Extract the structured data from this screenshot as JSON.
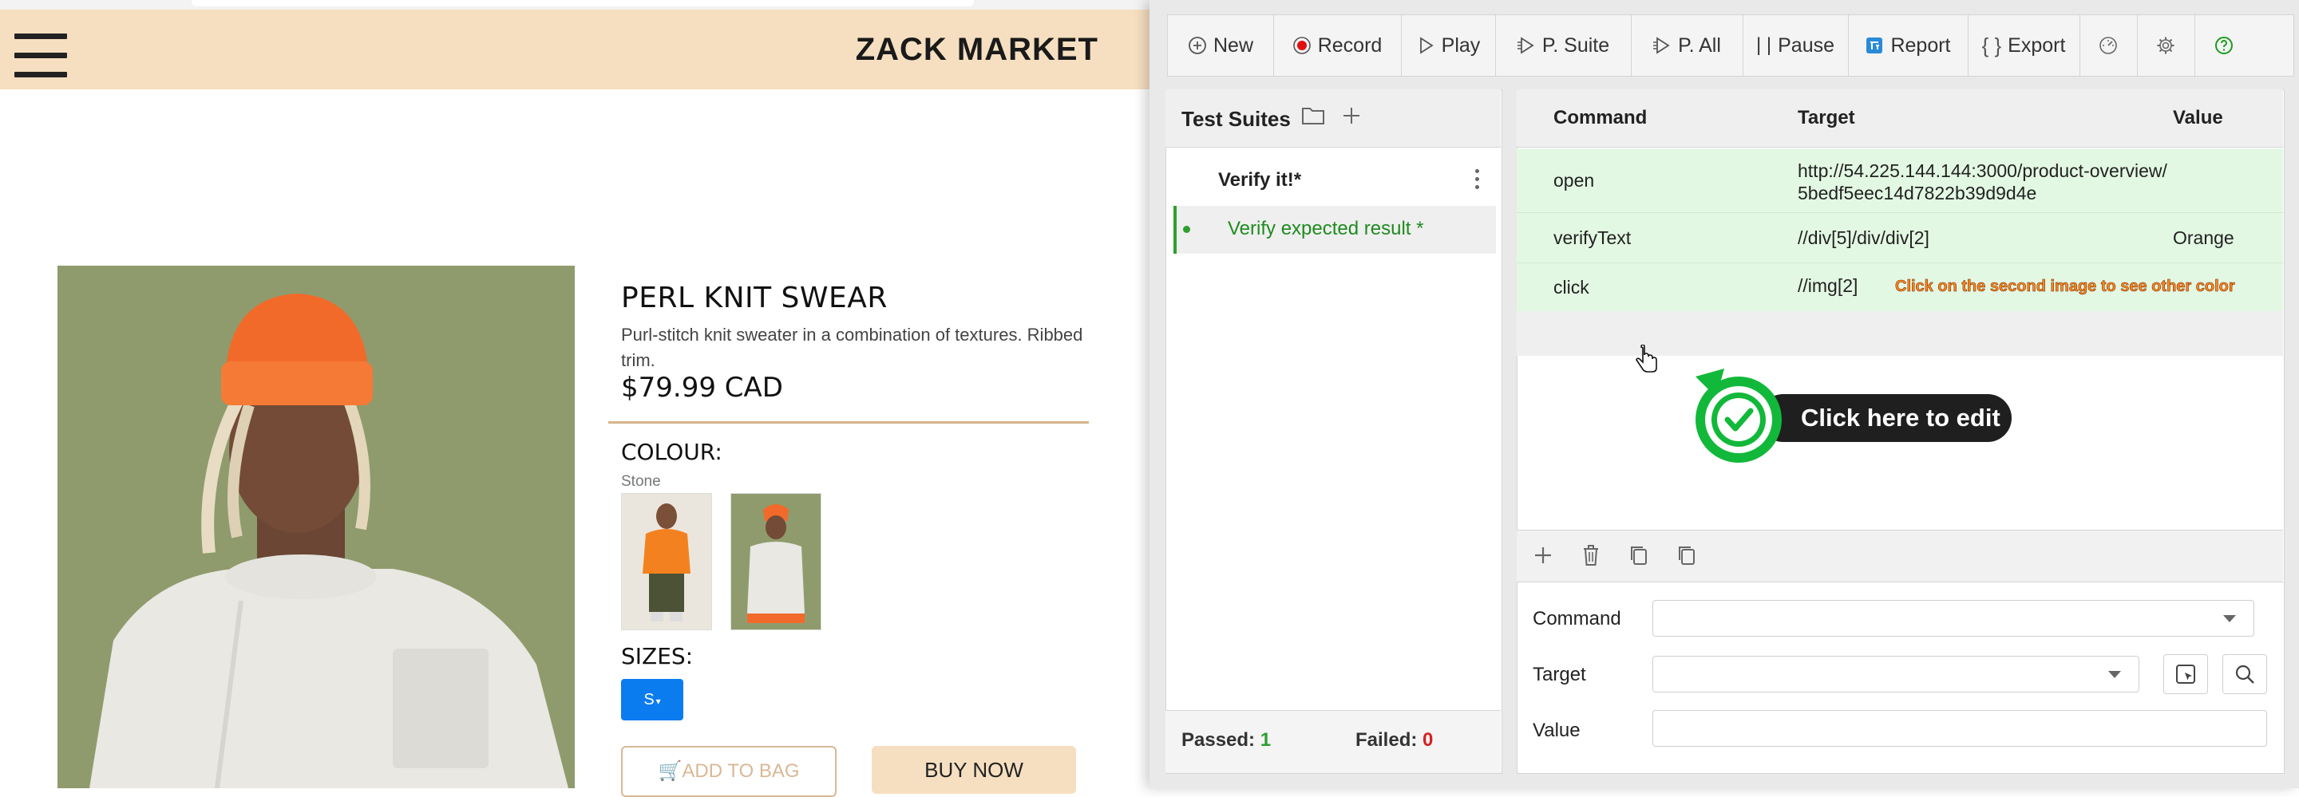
{
  "site": {
    "brand": "ZACK MARKET",
    "product": {
      "title": "PERL KNIT SWEAR",
      "description": "Purl-stitch knit sweater in a combination of textures. Ribbed trim.",
      "price": "$79.99 CAD",
      "colour_label": "COLOUR:",
      "colour_value": "Stone",
      "sizes_label": "SIZES:",
      "size_selected": "S",
      "add_to_bag": "ADD TO BAG",
      "buy_now": "BUY NOW"
    }
  },
  "ide": {
    "toolbar": {
      "new": "New",
      "record": "Record",
      "play": "Play",
      "play_suite": "P. Suite",
      "play_all": "P. All",
      "pause": "Pause",
      "report": "Report",
      "export": "Export"
    },
    "suites": {
      "title": "Test Suites",
      "suite_name": "Verify it!*",
      "test_name": "Verify expected result *",
      "passed_label": "Passed:",
      "passed_count": "1",
      "failed_label": "Failed:",
      "failed_count": "0"
    },
    "table": {
      "headers": {
        "command": "Command",
        "target": "Target",
        "value": "Value"
      },
      "rows": [
        {
          "command": "open",
          "target": "http://54.225.144.144:3000/product-overview/5bedf5eec14d7822b39d9d4e",
          "value": ""
        },
        {
          "command": "verifyText",
          "target": "//div[5]/div/div[2]",
          "value": "Orange"
        },
        {
          "command": "click",
          "target": "//img[2]",
          "value": "",
          "comment": "Click on the second image to see other color"
        }
      ]
    },
    "edit_badge": "Click here to edit",
    "editor": {
      "command_label": "Command",
      "target_label": "Target",
      "value_label": "Value",
      "command_value": "",
      "target_value": "",
      "value_value": ""
    },
    "colors": {
      "pass_green": "#2e9e2e",
      "row_green": "#e3f8e3",
      "fail_red": "#d62020",
      "record_red": "#e01010"
    }
  }
}
